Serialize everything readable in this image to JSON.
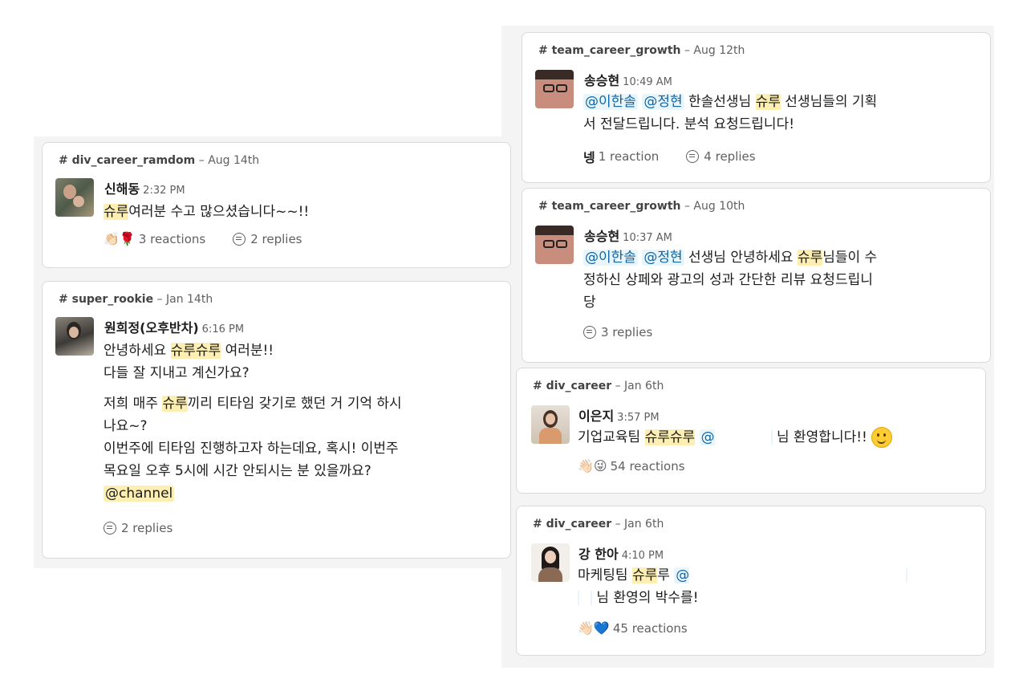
{
  "left_cards": [
    {
      "channel": "div_career_ramdom",
      "date": "Aug 14th",
      "author": "신해동",
      "time": "2:32 PM",
      "body": {
        "hl1": "슈루",
        "t1": "여러분 수고 많으셨습니다~~!!"
      },
      "reactions": {
        "emojis": "👏🏻🌹",
        "count": "3 reactions"
      },
      "replies": "2 replies"
    },
    {
      "channel": "super_rookie",
      "date": "Jan 14th",
      "author": "원희정(오후반차)",
      "time": "6:16 PM",
      "body": {
        "l1_a": "안녕하세요 ",
        "l1_hl": "슈루슈루",
        "l1_b": " 여러분!!",
        "l2": "다들 잘 지내고 계신가요?",
        "l3_a": "저희 매주 ",
        "l3_hl": "슈루",
        "l3_b": "끼리 티타임 갖기로 했던 거 기억 하시",
        "l4": "나요~?",
        "l5": "이번주에 티타임 진행하고자 하는데요, 혹시! 이번주",
        "l6": "목요일 오후 5시에 시간 안되시는 분 있을까요?",
        "channel_mention": "@channel"
      },
      "replies": "2 replies"
    }
  ],
  "right_cards": [
    {
      "channel": "team_career_growth",
      "date": "Aug 12th",
      "author": "송승현",
      "time": "10:49 AM",
      "body": {
        "m1": "@이한솔",
        "m2": "@정현",
        "a": " 한솔선생님 ",
        "hl": "슈루",
        "b": " 선생님들의 기획",
        "l2": "서 전달드립니다. 분석 요청드립니다!"
      },
      "reactions": {
        "emojis": "넹",
        "count": "1 reaction"
      },
      "replies": "4 replies"
    },
    {
      "channel": "team_career_growth",
      "date": "Aug 10th",
      "author": "송승현",
      "time": "10:37 AM",
      "body": {
        "m1": "@이한솔",
        "m2": "@정현",
        "a": " 선생님 안녕하세요 ",
        "hl": "슈루",
        "b": "님들이 수",
        "l2": "정하신 상페와 광고의 성과 간단한 리뷰 요청드립니",
        "l3": "당"
      },
      "replies": "3 replies"
    },
    {
      "channel": "div_career",
      "date": "Jan 6th",
      "author": "이은지",
      "time": "3:57 PM",
      "body": {
        "a": "기업교육팀 ",
        "hl": "슈루슈루",
        "m": "@",
        "b": "님 환영합니다!!"
      },
      "reactions": {
        "emojis": "👋🏻😜",
        "count": "54 reactions"
      }
    },
    {
      "channel": "div_career",
      "date": "Jan 6th",
      "author": "강 한아",
      "time": "4:10 PM",
      "body": {
        "a": "마케팅팀 ",
        "hl": "슈루",
        "b": "루 ",
        "m": "@",
        "l2": "님 환영의 박수를!"
      },
      "reactions": {
        "emojis": "👋🏻💙",
        "count": "45 reactions"
      }
    }
  ],
  "colors": {
    "highlight": "#fdefb2",
    "mention_bg": "#e8f5fa",
    "mention_text": "#1264a3"
  }
}
